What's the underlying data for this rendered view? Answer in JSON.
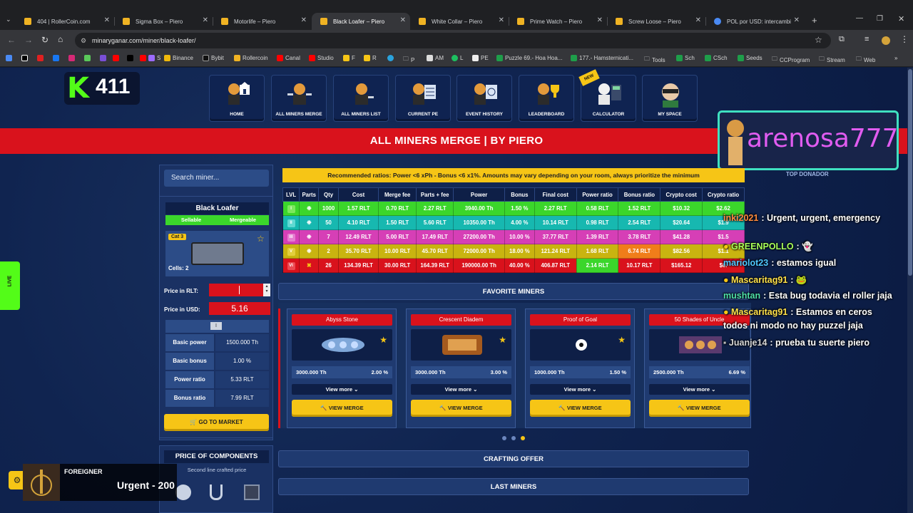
{
  "tabs": [
    {
      "label": "404 | RollerCoin.com"
    },
    {
      "label": "Sigma Box – Piero"
    },
    {
      "label": "Motorlife – Piero"
    },
    {
      "label": "Black Loafer – Piero"
    },
    {
      "label": "White Collar – Piero"
    },
    {
      "label": "Prime Watch – Piero"
    },
    {
      "label": "Screw Loose – Piero"
    },
    {
      "label": "POL por USD: intercambi"
    }
  ],
  "address": {
    "url": "minaryganar.com/miner/black-loafer/"
  },
  "bookmarks": [
    "S",
    "Binance",
    "Bybit",
    "Rollercoin",
    "Canal",
    "Studio",
    "F",
    "R",
    "P",
    "AM",
    "L",
    "PE",
    "Puzzle 69.- Hoa Hoa...",
    "177.- Hamsternicati...",
    "Tools",
    "Sch",
    "CSch",
    "Seeds",
    "CCProgram",
    "Stream",
    "Web"
  ],
  "kick": {
    "logo": "K",
    "viewers": "411"
  },
  "nav": [
    {
      "label": "HOME"
    },
    {
      "label": "ALL MINERS MERGE"
    },
    {
      "label": "ALL MINERS LIST"
    },
    {
      "label": "CURRENT PE"
    },
    {
      "label": "EVENT HISTORY"
    },
    {
      "label": "LEADERBOARD"
    },
    {
      "label": "CALCULATOR",
      "badge": "NEW"
    },
    {
      "label": "MY SPACE"
    }
  ],
  "banner": {
    "title": "ALL MINERS MERGE | BY PIERO"
  },
  "donor": {
    "name": "arenosa777",
    "caption": "TOP DONADOR"
  },
  "live_tab": {
    "label": "LIVE"
  },
  "sidebar": {
    "search_placeholder": "Search miner...",
    "miner_name": "Black Loafer",
    "tag_sellable": "Sellable",
    "tag_mergeable": "Mergeable",
    "cat": "Cat 3",
    "cells": "Cells: 2",
    "price_rlt_label": "Price in RLT:",
    "price_usd_label": "Price in USD:",
    "price_usd_value": "5.16",
    "level_tag": "I",
    "stats": [
      {
        "label": "Basic power",
        "value": "1500.000 Th"
      },
      {
        "label": "Basic bonus",
        "value": "1.00 %"
      },
      {
        "label": "Power ratio",
        "value": "5.33 RLT"
      },
      {
        "label": "Bonus ratio",
        "value": "7.99 RLT"
      }
    ],
    "market_button": "GO TO MARKET",
    "components_title": "PRICE OF COMPONENTS",
    "components_sub": "Second line crafted price"
  },
  "notice": "Recommended ratios: Power <6 xPh - Bonus <6 x1%. Amounts may vary depending on your room, always prioritize the minimum",
  "table": {
    "headers": [
      "LVL",
      "Parts",
      "Qty",
      "Cost",
      "Merge fee",
      "Parts + fee",
      "Power",
      "Bonus",
      "Final cost",
      "Power ratio",
      "Bonus ratio",
      "Crypto cost",
      "Crypto ratio"
    ],
    "rows": [
      {
        "lvl": "I",
        "qty": "1000",
        "cost": "1.57 RLT",
        "fee": "0.70 RLT",
        "pf": "2.27 RLT",
        "power": "3940.00 Th",
        "bonus": "1.50 %",
        "final": "2.27 RLT",
        "pr": "0.58 RLT",
        "br": "1.52 RLT",
        "cc": "$10.32",
        "cr": "$2.62"
      },
      {
        "lvl": "II",
        "qty": "50",
        "cost": "4.10 RLT",
        "fee": "1.50 RLT",
        "pf": "5.60 RLT",
        "power": "10350.00 Th",
        "bonus": "4.00 %",
        "final": "10.14 RLT",
        "pr": "0.98 RLT",
        "br": "2.54 RLT",
        "cc": "$20.64",
        "cr": "$1.9"
      },
      {
        "lvl": "III",
        "qty": "7",
        "cost": "12.49 RLT",
        "fee": "5.00 RLT",
        "pf": "17.49 RLT",
        "power": "27200.00 Th",
        "bonus": "10.00 %",
        "final": "37.77 RLT",
        "pr": "1.39 RLT",
        "br": "3.78 RLT",
        "cc": "$41.28",
        "cr": "$1.5"
      },
      {
        "lvl": "V",
        "qty": "2",
        "cost": "35.70 RLT",
        "fee": "10.00 RLT",
        "pf": "45.70 RLT",
        "power": "72000.00 Th",
        "bonus": "18.00 %",
        "final": "121.24 RLT",
        "pr": "1.68 RLT",
        "br": "6.74 RLT",
        "cc": "$82.56",
        "cr": "$1.1"
      },
      {
        "lvl": "VI",
        "qty": "26",
        "cost": "134.39 RLT",
        "fee": "30.00 RLT",
        "pf": "164.39 RLT",
        "power": "190000.00 Th",
        "bonus": "40.00 %",
        "final": "406.87 RLT",
        "pr": "2.14 RLT",
        "br": "10.17 RLT",
        "cc": "$165.12",
        "cr": "$0."
      }
    ]
  },
  "favorites": {
    "title": "FAVORITE MINERS",
    "cards": [
      {
        "name": "Abyss Stone",
        "power": "3000.000 Th",
        "bonus": "2.00 %",
        "more": "View more",
        "cta": "VIEW MERGE"
      },
      {
        "name": "Crescent Diadem",
        "power": "3000.000 Th",
        "bonus": "3.00 %",
        "more": "View more",
        "cta": "VIEW MERGE"
      },
      {
        "name": "Proof of Goal",
        "power": "1000.000 Th",
        "bonus": "1.50 %",
        "more": "View more",
        "cta": "VIEW MERGE"
      },
      {
        "name": "50 Shades of Uncle",
        "power": "2500.000 Th",
        "bonus": "6.69 %",
        "more": "View more",
        "cta": "VIEW MERGE"
      }
    ]
  },
  "sections": {
    "crafting": "CRAFTING OFFER",
    "last": "LAST MINERS"
  },
  "music": {
    "artist": "FOREIGNER",
    "track": "Urgent - 200"
  },
  "chat": [
    {
      "user": "inki2021",
      "msg": ": Urgent, urgent, emergency",
      "color": "#ff8a3d"
    },
    {
      "user": "GREENPOLLO",
      "msg": ":",
      "color": "#a8ff5a"
    },
    {
      "user": "mariolot23",
      "msg": ": estamos igual",
      "color": "#4fc8ff"
    },
    {
      "user": "Mascaritag91",
      "msg": ":",
      "color": "#ffe14a"
    },
    {
      "user": "mushtan",
      "msg": ": Esta bug todavia el roller jaja",
      "color": "#4fe0a8"
    },
    {
      "user": "Mascaritag91",
      "msg": ": Estamos en ceros",
      "color": "#ffe14a"
    },
    {
      "user": "",
      "msg": "todos ni modo no hay puzzel jaja",
      "color": "#fff"
    },
    {
      "user": "Juanje14",
      "msg": ": prueba tu suerte piero",
      "color": "#d6d6d6"
    }
  ],
  "colors": {
    "rowI": "#3bd62b",
    "rowII": "#17b8b0",
    "rowIII": "#d63fb6",
    "rowV": "#c9b410",
    "rowVI": "#d9121c",
    "accent": "#f6c516"
  }
}
